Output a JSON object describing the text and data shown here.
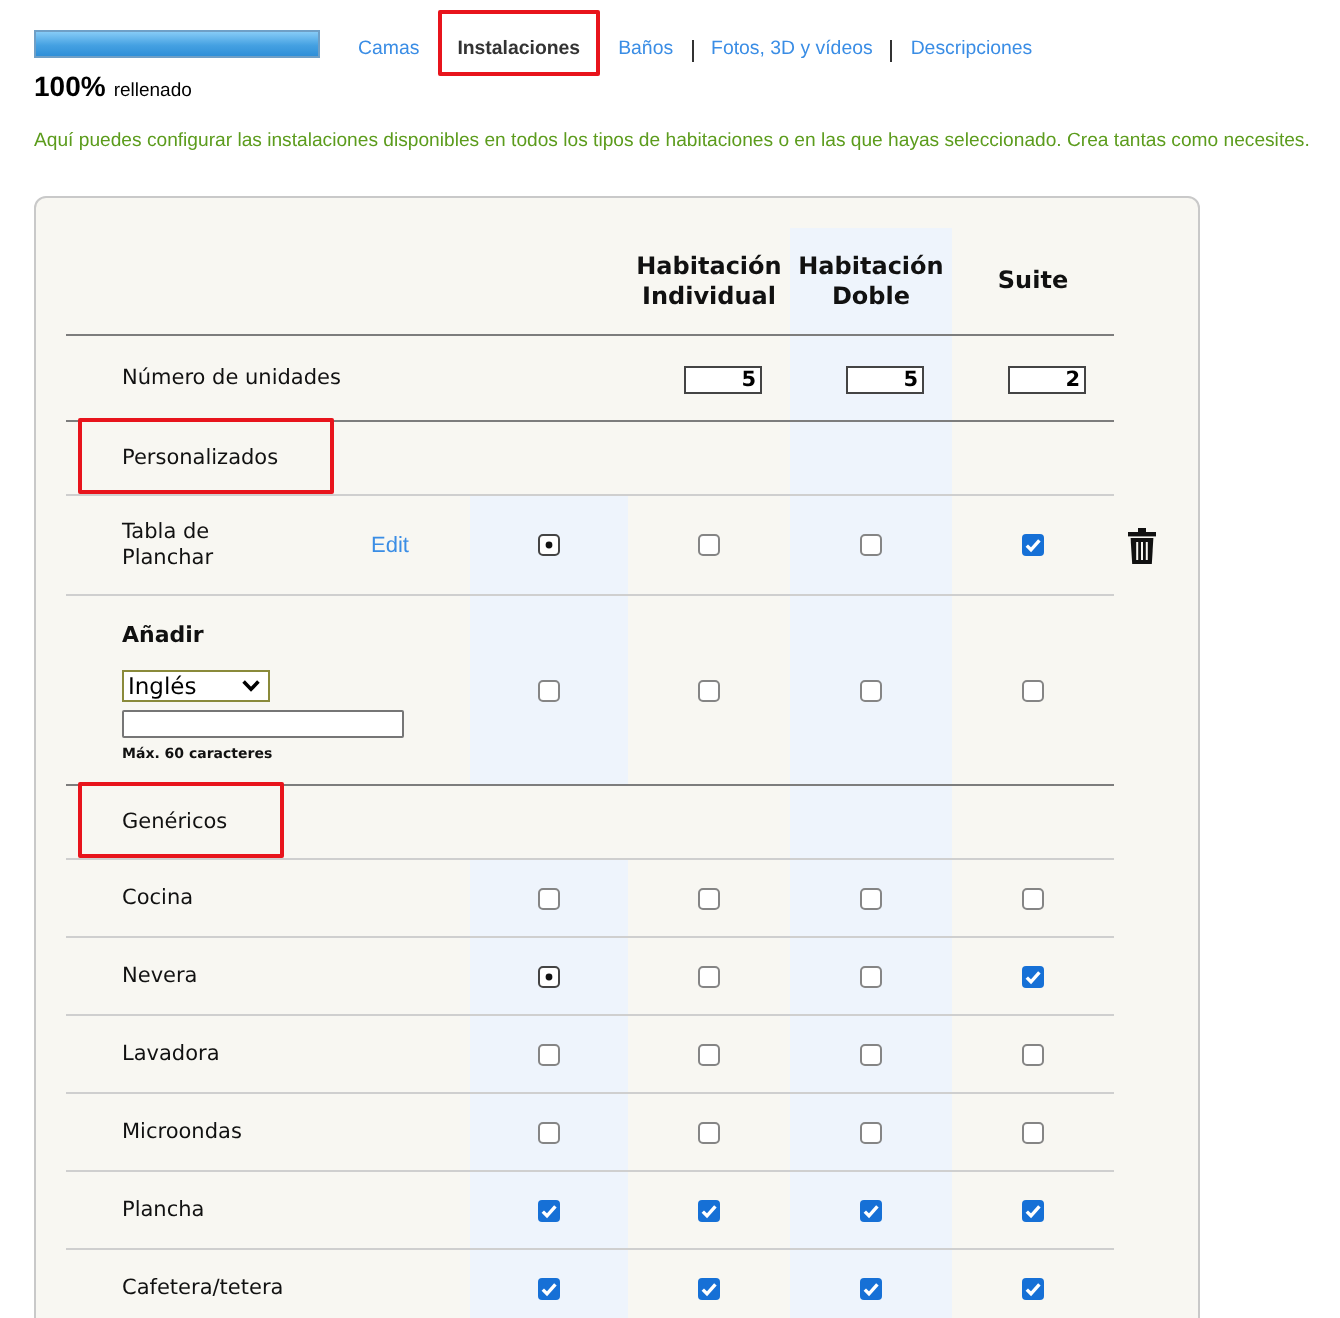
{
  "progress": {
    "level": 1,
    "percent": "100%",
    "caption": "rellenado"
  },
  "tabs": [
    {
      "label": "Camas",
      "selected": false,
      "marked": false
    },
    {
      "label": "Instalaciones",
      "selected": true,
      "marked": true
    },
    {
      "label": "Baños",
      "selected": false,
      "marked": false
    },
    {
      "label": "Fotos, 3D y vídeos",
      "selected": false,
      "marked": false
    },
    {
      "label": "Descripciones",
      "selected": false,
      "marked": false
    }
  ],
  "intro": "Aquí puedes configurar las instalaciones disponibles en todos los tipos de habitaciones o en las que hayas seleccionado. Crea tantas como necesites.",
  "room_types": [
    {
      "name": "Habitación Individual",
      "units": "5"
    },
    {
      "name": "Habitación Doble",
      "units": "5"
    },
    {
      "name": "Suite",
      "units": "2"
    }
  ],
  "units_label": "Número de unidades",
  "sections": [
    {
      "title": "Personalizados",
      "marked": true,
      "items": [
        {
          "label": "Tabla de Planchar",
          "edit": "Edit",
          "deletable": true,
          "cells": [
            {
              "checked": false,
              "mixed": true
            },
            {
              "checked": false,
              "mixed": false
            },
            {
              "checked": false,
              "mixed": false
            },
            {
              "checked": true,
              "mixed": false
            }
          ]
        }
      ],
      "add_form": {
        "title": "Añadir",
        "language": "Inglés",
        "hint": "Máx. 60 caracteres",
        "cells": [
          {
            "checked": false,
            "mixed": false
          },
          {
            "checked": false,
            "mixed": false
          },
          {
            "checked": false,
            "mixed": false
          },
          {
            "checked": false,
            "mixed": false
          }
        ]
      }
    },
    {
      "title": "Genéricos",
      "marked": true,
      "items": [
        {
          "label": "Cocina",
          "deletable": false,
          "cells": [
            {
              "checked": false,
              "mixed": false
            },
            {
              "checked": false,
              "mixed": false
            },
            {
              "checked": false,
              "mixed": false
            },
            {
              "checked": false,
              "mixed": false
            }
          ]
        },
        {
          "label": "Nevera",
          "deletable": false,
          "cells": [
            {
              "checked": false,
              "mixed": true
            },
            {
              "checked": false,
              "mixed": false
            },
            {
              "checked": false,
              "mixed": false
            },
            {
              "checked": true,
              "mixed": false
            }
          ]
        },
        {
          "label": "Lavadora",
          "deletable": false,
          "cells": [
            {
              "checked": false,
              "mixed": false
            },
            {
              "checked": false,
              "mixed": false
            },
            {
              "checked": false,
              "mixed": false
            },
            {
              "checked": false,
              "mixed": false
            }
          ]
        },
        {
          "label": "Microondas",
          "deletable": false,
          "cells": [
            {
              "checked": false,
              "mixed": false
            },
            {
              "checked": false,
              "mixed": false
            },
            {
              "checked": false,
              "mixed": false
            },
            {
              "checked": false,
              "mixed": false
            }
          ]
        },
        {
          "label": "Plancha",
          "deletable": false,
          "cells": [
            {
              "checked": true,
              "mixed": false
            },
            {
              "checked": true,
              "mixed": false
            },
            {
              "checked": true,
              "mixed": false
            },
            {
              "checked": true,
              "mixed": false
            }
          ]
        },
        {
          "label": "Cafetera/tetera",
          "deletable": false,
          "cells": [
            {
              "checked": true,
              "mixed": false
            },
            {
              "checked": true,
              "mixed": false
            },
            {
              "checked": true,
              "mixed": false
            },
            {
              "checked": true,
              "mixed": false
            }
          ]
        }
      ]
    }
  ]
}
